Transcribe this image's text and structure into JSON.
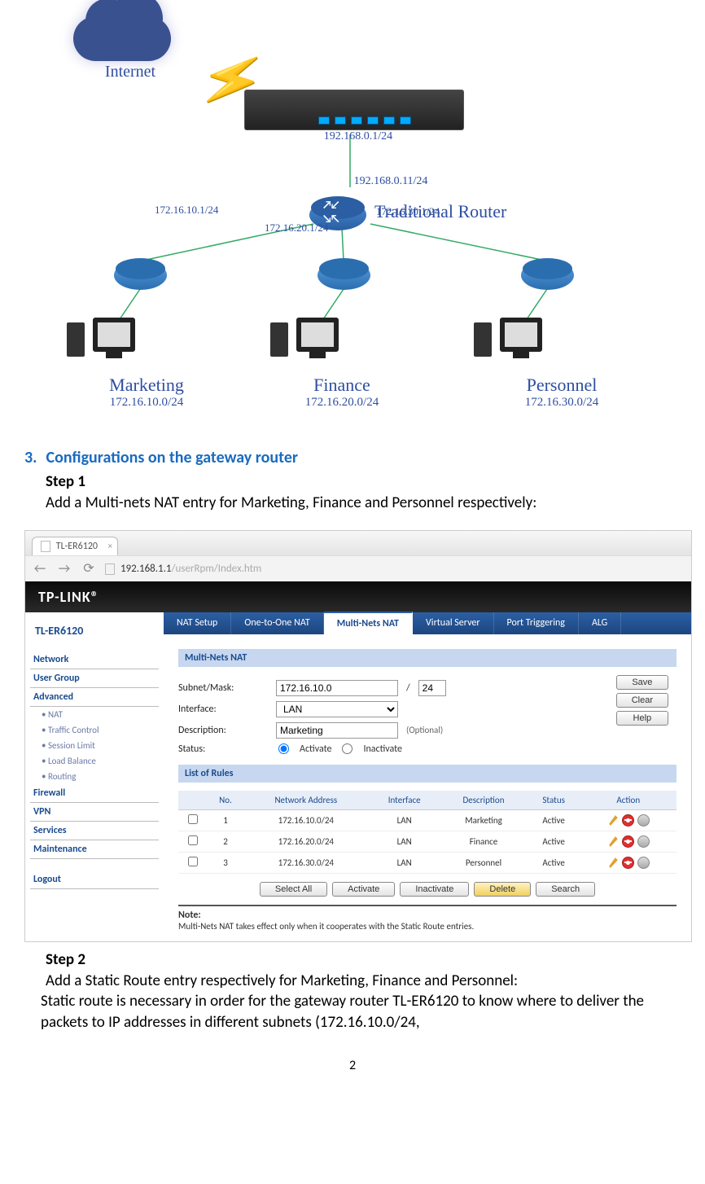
{
  "diagram": {
    "internet_label": "Internet",
    "gateway_ip": "192.168.0.1/24",
    "trouter_top_ip": "192.168.0.11/24",
    "trouter_label": "Traditional Router",
    "trouter_ip_left": "172.16.10.1/24",
    "trouter_ip_mid": "172.16.20.1/24",
    "trouter_ip_right": "172.16.30.1/24",
    "depts": [
      {
        "name": "Marketing",
        "ip": "172.16.10.0/24"
      },
      {
        "name": "Finance",
        "ip": "172.16.20.0/24"
      },
      {
        "name": "Personnel",
        "ip": "172.16.30.0/24"
      }
    ]
  },
  "doc": {
    "section_num": "3.",
    "section_title": "Configurations on the gateway router",
    "step1": "Step 1",
    "step1_text": "Add a Multi-nets NAT entry for Marketing, Finance and Personnel respectively:",
    "step2": "Step 2",
    "step2_line1": "Add a Static Route entry respectively for Marketing, Finance and Personnel:",
    "step2_line2": "Static route is necessary in order for the gateway router TL-ER6120 to know where to deliver the packets to IP addresses in different subnets (172.16.10.0/24,",
    "page_number": "2"
  },
  "browser": {
    "tab_title": "TL-ER6120",
    "url_host": "192.168.1.1",
    "url_path": "/userRpm/Index.htm"
  },
  "admin": {
    "brand": "TP-LINK®",
    "model": "TL-ER6120",
    "nav": {
      "network": "Network",
      "usergroup": "User Group",
      "advanced": "Advanced",
      "sub_nat": "NAT",
      "sub_traffic": "Traffic Control",
      "sub_session": "Session Limit",
      "sub_load": "Load Balance",
      "sub_routing": "Routing",
      "firewall": "Firewall",
      "vpn": "VPN",
      "services": "Services",
      "maintenance": "Maintenance",
      "logout": "Logout"
    },
    "tabs": {
      "nat_setup": "NAT Setup",
      "one_to_one": "One-to-One NAT",
      "multi_nets": "Multi-Nets NAT",
      "virtual_server": "Virtual Server",
      "port_trig": "Port Triggering",
      "alg": "ALG"
    },
    "panel": {
      "head1": "Multi-Nets NAT",
      "l_subnet": "Subnet/Mask:",
      "v_subnet": "172.16.10.0",
      "v_mask": "24",
      "l_interface": "Interface:",
      "v_interface": "LAN",
      "l_desc": "Description:",
      "v_desc": "Marketing",
      "desc_opt": "(Optional)",
      "l_status": "Status:",
      "r_activate": "Activate",
      "r_inactivate": "Inactivate",
      "btn_save": "Save",
      "btn_clear": "Clear",
      "btn_help": "Help",
      "head2": "List of Rules",
      "th_no": "No.",
      "th_addr": "Network Address",
      "th_if": "Interface",
      "th_desc": "Description",
      "th_status": "Status",
      "th_action": "Action",
      "rows": [
        {
          "no": "1",
          "addr": "172.16.10.0/24",
          "if": "LAN",
          "desc": "Marketing",
          "status": "Active"
        },
        {
          "no": "2",
          "addr": "172.16.20.0/24",
          "if": "LAN",
          "desc": "Finance",
          "status": "Active"
        },
        {
          "no": "3",
          "addr": "172.16.30.0/24",
          "if": "LAN",
          "desc": "Personnel",
          "status": "Active"
        }
      ],
      "btn_selall": "Select All",
      "btn_activate": "Activate",
      "btn_inactivate": "Inactivate",
      "btn_delete": "Delete",
      "btn_search": "Search",
      "note_head": "Note:",
      "note_text": "Multi-Nets NAT takes effect only when it cooperates with the Static Route entries."
    }
  }
}
